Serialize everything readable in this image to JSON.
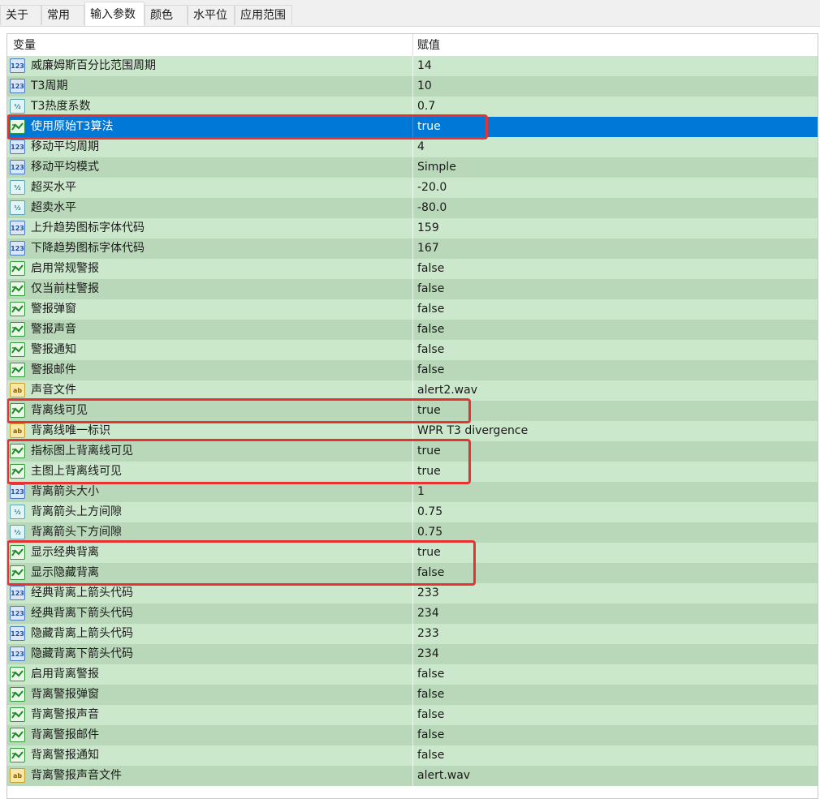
{
  "tabs": [
    {
      "label": "关于"
    },
    {
      "label": "常用"
    },
    {
      "label": "输入参数"
    },
    {
      "label": "颜色"
    },
    {
      "label": "水平位"
    },
    {
      "label": "应用范围"
    }
  ],
  "active_tab": "输入参数",
  "columns": {
    "variable": "变量",
    "value": "赋值"
  },
  "icon_types": {
    "int": {
      "icon": "int-icon",
      "glyph": "123"
    },
    "double": {
      "icon": "double-icon",
      "glyph": "½"
    },
    "bool": {
      "icon": "bool-icon",
      "glyph": ""
    },
    "string": {
      "icon": "string-icon",
      "glyph": "ab"
    }
  },
  "params": [
    {
      "type": "int",
      "name": "威廉姆斯百分比范围周期",
      "value": "14"
    },
    {
      "type": "int",
      "name": "T3周期",
      "value": "10"
    },
    {
      "type": "double",
      "name": "T3热度系数",
      "value": "0.7"
    },
    {
      "type": "bool",
      "name": "使用原始T3算法",
      "value": "true",
      "selected": true
    },
    {
      "type": "int",
      "name": "移动平均周期",
      "value": "4"
    },
    {
      "type": "int",
      "name": "移动平均模式",
      "value": "Simple"
    },
    {
      "type": "double",
      "name": "超买水平",
      "value": "-20.0"
    },
    {
      "type": "double",
      "name": "超卖水平",
      "value": "-80.0"
    },
    {
      "type": "int",
      "name": "上升趋势图标字体代码",
      "value": "159"
    },
    {
      "type": "int",
      "name": "下降趋势图标字体代码",
      "value": "167"
    },
    {
      "type": "bool",
      "name": "启用常规警报",
      "value": "false"
    },
    {
      "type": "bool",
      "name": "仅当前柱警报",
      "value": "false"
    },
    {
      "type": "bool",
      "name": "警报弹窗",
      "value": "false"
    },
    {
      "type": "bool",
      "name": "警报声音",
      "value": "false"
    },
    {
      "type": "bool",
      "name": "警报通知",
      "value": "false"
    },
    {
      "type": "bool",
      "name": "警报邮件",
      "value": "false"
    },
    {
      "type": "string",
      "name": "声音文件",
      "value": "alert2.wav"
    },
    {
      "type": "bool",
      "name": "背离线可见",
      "value": "true"
    },
    {
      "type": "string",
      "name": "背离线唯一标识",
      "value": "WPR T3 divergence"
    },
    {
      "type": "bool",
      "name": "指标图上背离线可见",
      "value": "true"
    },
    {
      "type": "bool",
      "name": "主图上背离线可见",
      "value": "true"
    },
    {
      "type": "int",
      "name": "背离箭头大小",
      "value": "1"
    },
    {
      "type": "double",
      "name": "背离箭头上方间隙",
      "value": "0.75"
    },
    {
      "type": "double",
      "name": "背离箭头下方间隙",
      "value": "0.75"
    },
    {
      "type": "bool",
      "name": "显示经典背离",
      "value": "true"
    },
    {
      "type": "bool",
      "name": "显示隐藏背离",
      "value": "false"
    },
    {
      "type": "int",
      "name": "经典背离上箭头代码",
      "value": "233"
    },
    {
      "type": "int",
      "name": "经典背离下箭头代码",
      "value": "234"
    },
    {
      "type": "int",
      "name": "隐藏背离上箭头代码",
      "value": "233"
    },
    {
      "type": "int",
      "name": "隐藏背离下箭头代码",
      "value": "234"
    },
    {
      "type": "bool",
      "name": "启用背离警报",
      "value": "false"
    },
    {
      "type": "bool",
      "name": "背离警报弹窗",
      "value": "false"
    },
    {
      "type": "bool",
      "name": "背离警报声音",
      "value": "false"
    },
    {
      "type": "bool",
      "name": "背离警报邮件",
      "value": "false"
    },
    {
      "type": "bool",
      "name": "背离警报通知",
      "value": "false"
    },
    {
      "type": "string",
      "name": "背离警报声音文件",
      "value": "alert.wav"
    }
  ],
  "colors": {
    "selection": "#0078d7",
    "row_light": "#cce8cc",
    "row_dark": "#b9d8b9",
    "highlight": "#e53333"
  },
  "highlight_groups": [
    {
      "rows": [
        3
      ]
    },
    {
      "rows": [
        17
      ]
    },
    {
      "rows": [
        19,
        20
      ]
    },
    {
      "rows": [
        24,
        25
      ]
    }
  ]
}
